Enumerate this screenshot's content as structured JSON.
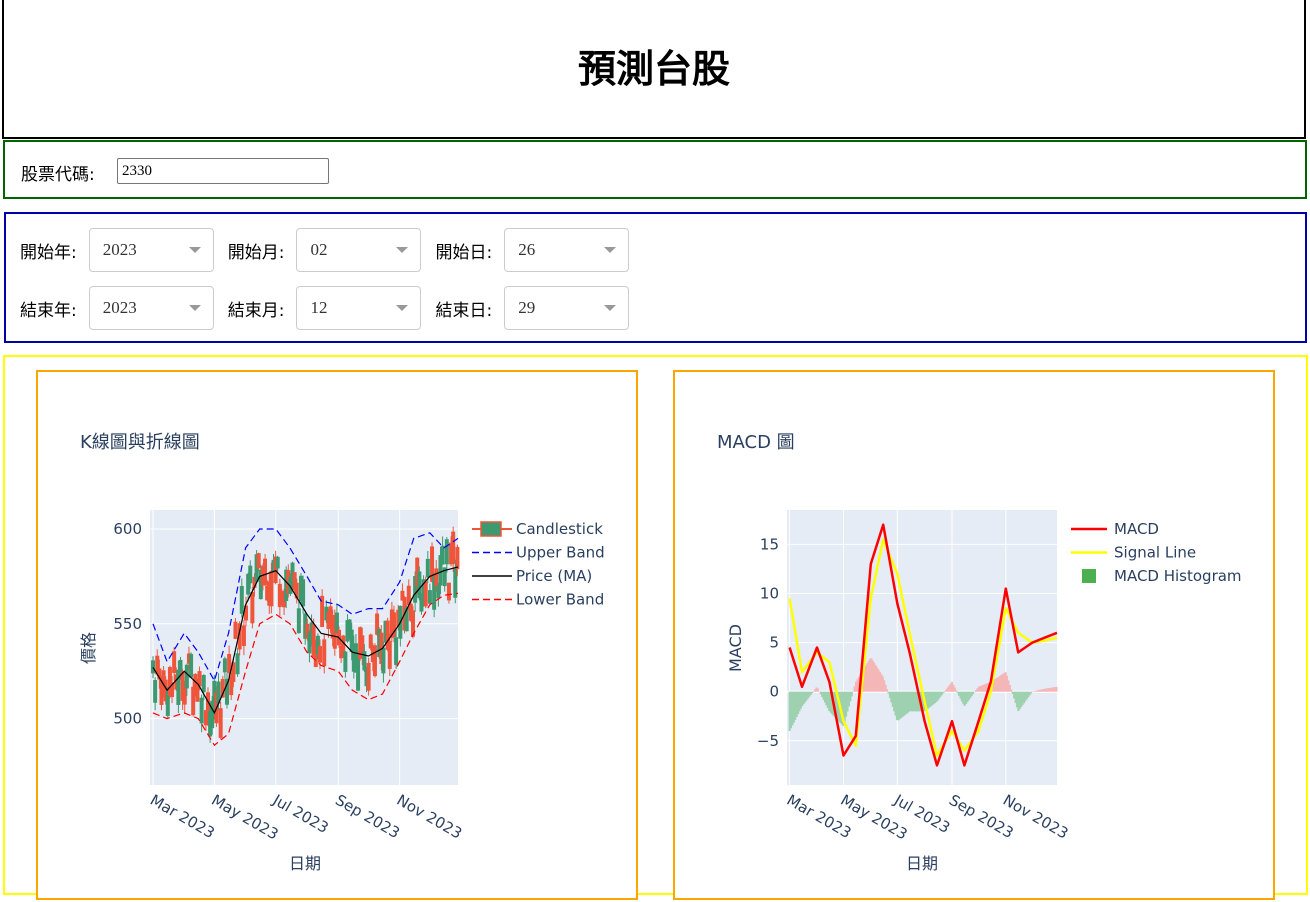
{
  "page": {
    "title": "預測台股"
  },
  "stock": {
    "label": "股票代碼:",
    "value": "2330"
  },
  "dates": {
    "start_year": {
      "label": "開始年:",
      "value": "2023"
    },
    "start_month": {
      "label": "開始月:",
      "value": "02"
    },
    "start_day": {
      "label": "開始日:",
      "value": "26"
    },
    "end_year": {
      "label": "結束年:",
      "value": "2023"
    },
    "end_month": {
      "label": "結束月:",
      "value": "12"
    },
    "end_day": {
      "label": "結束日:",
      "value": "29"
    }
  },
  "chart_data": [
    {
      "type": "candlestick",
      "title": "K線圖與折線圖",
      "xlabel": "日期",
      "ylabel": "價格",
      "x_ticks": [
        "Mar 2023",
        "May 2023",
        "Jul 2023",
        "Sep 2023",
        "Nov 2023"
      ],
      "y_ticks": [
        500,
        550,
        600
      ],
      "xlim": [
        "2023-02-26",
        "2023-12-29"
      ],
      "ylim": [
        465,
        610
      ],
      "legend": [
        "Candlestick",
        "Upper Band",
        "Price (MA)",
        "Lower Band"
      ],
      "legend_position": "right",
      "colors": {
        "increasing": "#3d9970",
        "decreasing": "#ef553b",
        "upper": "#0000ff",
        "ma": "#000000",
        "lower": "#ff0000"
      },
      "x": [
        "2023-03-01",
        "2023-03-15",
        "2023-04-01",
        "2023-04-15",
        "2023-05-01",
        "2023-05-15",
        "2023-06-01",
        "2023-06-15",
        "2023-07-01",
        "2023-07-15",
        "2023-08-01",
        "2023-08-15",
        "2023-09-01",
        "2023-09-15",
        "2023-10-01",
        "2023-10-15",
        "2023-11-01",
        "2023-11-15",
        "2023-12-01",
        "2023-12-15",
        "2023-12-29"
      ],
      "ma": [
        527,
        515,
        525,
        518,
        503,
        520,
        560,
        575,
        578,
        570,
        555,
        545,
        543,
        535,
        533,
        537,
        550,
        565,
        575,
        578,
        580
      ],
      "upper": [
        550,
        530,
        545,
        535,
        520,
        545,
        590,
        600,
        600,
        590,
        575,
        562,
        560,
        555,
        558,
        558,
        572,
        595,
        598,
        590,
        595
      ],
      "lower": [
        503,
        500,
        503,
        500,
        486,
        492,
        525,
        550,
        555,
        550,
        535,
        528,
        525,
        515,
        510,
        513,
        530,
        545,
        560,
        565,
        566
      ]
    },
    {
      "type": "line",
      "title": "MACD 圖",
      "xlabel": "日期",
      "ylabel": "MACD",
      "x_ticks": [
        "Mar 2023",
        "May 2023",
        "Jul 2023",
        "Sep 2023",
        "Nov 2023"
      ],
      "y_ticks": [
        -5,
        0,
        5,
        10,
        15
      ],
      "xlim": [
        "2023-02-26",
        "2023-12-29"
      ],
      "ylim": [
        -9.5,
        18.5
      ],
      "legend": [
        "MACD",
        "Signal Line",
        "MACD Histogram"
      ],
      "legend_position": "right",
      "colors": {
        "macd": "#ff0000",
        "signal": "#ffff00",
        "hist_pos": "#f4b6b6",
        "hist_neg": "#9ed1b0",
        "legend_hist": "#4caf50"
      },
      "x": [
        "2023-03-01",
        "2023-03-15",
        "2023-04-01",
        "2023-04-15",
        "2023-05-01",
        "2023-05-15",
        "2023-06-01",
        "2023-06-15",
        "2023-07-01",
        "2023-07-15",
        "2023-08-01",
        "2023-08-15",
        "2023-09-01",
        "2023-09-15",
        "2023-10-01",
        "2023-10-15",
        "2023-11-01",
        "2023-11-15",
        "2023-12-01",
        "2023-12-15",
        "2023-12-29"
      ],
      "macd": [
        4.5,
        0.5,
        4.5,
        1,
        -6.5,
        -4.5,
        13,
        17,
        9,
        4,
        -3,
        -7.5,
        -3,
        -7.5,
        -3,
        1,
        10.5,
        4,
        5,
        5.5,
        6
      ],
      "signal": [
        9.5,
        2,
        4,
        3,
        -3,
        -5.5,
        9.5,
        15.5,
        12,
        6,
        -1,
        -6.5,
        -4,
        -6,
        -4,
        0,
        8.5,
        6,
        5,
        5.2,
        5.5
      ],
      "hist": [
        -4,
        -1.5,
        0.5,
        -2,
        -3.5,
        1,
        3.5,
        1.5,
        -3,
        -2,
        -2,
        -1,
        1,
        -1.5,
        0.5,
        1,
        2,
        -2,
        0,
        0.3,
        0.5
      ]
    }
  ]
}
